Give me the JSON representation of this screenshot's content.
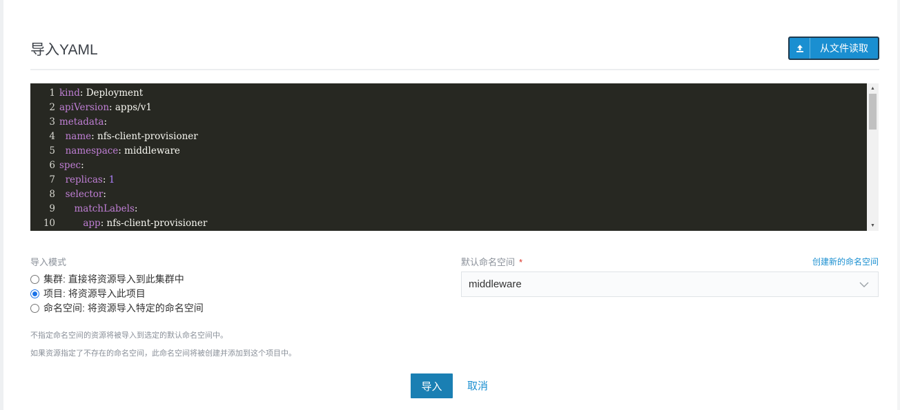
{
  "header": {
    "title": "导入YAML",
    "read_file_button": "从文件读取",
    "upload_icon": "upload-icon"
  },
  "editor": {
    "lines": [
      {
        "num": "1",
        "key": "kind",
        "val": " Deployment",
        "indent": ""
      },
      {
        "num": "2",
        "key": "apiVersion",
        "val": " apps/v1",
        "indent": ""
      },
      {
        "num": "3",
        "key": "metadata",
        "val": "",
        "indent": ""
      },
      {
        "num": "4",
        "key": "name",
        "val": " nfs-client-provisioner",
        "indent": "  "
      },
      {
        "num": "5",
        "key": "namespace",
        "val": " middleware",
        "indent": "  "
      },
      {
        "num": "6",
        "key": "spec",
        "val": "",
        "indent": ""
      },
      {
        "num": "7",
        "key": "replicas",
        "val": " 1",
        "indent": "  "
      },
      {
        "num": "8",
        "key": "selector",
        "val": "",
        "indent": "  "
      },
      {
        "num": "9",
        "key": "matchLabels",
        "val": "",
        "indent": "     "
      },
      {
        "num": "10",
        "key": "app",
        "val": " nfs-client-provisioner",
        "indent": "        "
      }
    ]
  },
  "import_mode": {
    "label": "导入模式",
    "options": [
      {
        "label": "集群: 直接将资源导入到此集群中",
        "selected": false
      },
      {
        "label": "项目: 将资源导入此项目",
        "selected": true
      },
      {
        "label": "命名空间: 将资源导入特定的命名空间",
        "selected": false
      }
    ]
  },
  "namespace": {
    "label": "默认命名空间",
    "required_mark": "*",
    "create_link": "创建新的命名空间",
    "selected": "middleware"
  },
  "help": {
    "line1": "不指定命名空间的资源将被导入到选定的默认命名空间中。",
    "line2": "如果资源指定了不存在的命名空间，此命名空间将被创建并添加到这个项目中。"
  },
  "footer": {
    "import_button": "导入",
    "cancel_button": "取消"
  },
  "colors": {
    "primary": "#1a8fd1",
    "editor_bg": "#272822",
    "key_color": "#c07fd6",
    "number_color": "#ae81ff"
  }
}
